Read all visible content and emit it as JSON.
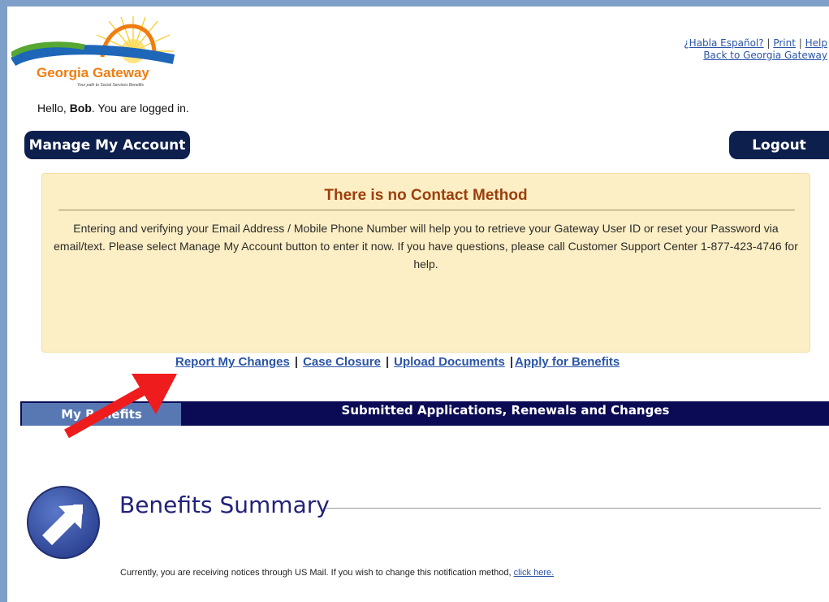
{
  "brand": {
    "name": "Georgia Gateway",
    "tagline": "Your path to Social Services Benefits"
  },
  "top_links": {
    "spanish": "¿Habla Español?",
    "print": "Print",
    "help": "Help",
    "back": "Back to Georgia Gateway",
    "separator": "|"
  },
  "greeting": {
    "prefix": "Hello,",
    "user": "Bob",
    "suffix": ". You are logged in."
  },
  "buttons": {
    "manage_account": "Manage My Account",
    "logout": "Logout"
  },
  "contact_notice": {
    "title": "There is no Contact Method",
    "body": "Entering and verifying your Email Address / Mobile Phone Number will help you to retrieve your Gateway User ID or reset your Password via email/text. Please select Manage My Account button to enter it now. If you have questions, please call Customer Support Center 1-877-423-4746 for help."
  },
  "quick_links": {
    "report_changes": "Report My Changes",
    "case_closure": "Case Closure",
    "upload_documents": "Upload Documents",
    "apply_benefits": "Apply for Benefits",
    "separator": "|"
  },
  "tabs": {
    "my_benefits": "My Benefits",
    "submitted": "Submitted Applications, Renewals and Changes"
  },
  "summary": {
    "title": "Benefits Summary",
    "mail_notice": "Currently, you are receiving notices through US Mail. If you wish to change this notification method,",
    "mail_link": "click here."
  },
  "colors": {
    "navy": "#0d1f4d",
    "tab_active": "#5878b4",
    "notice_bg": "#fdefc5",
    "notice_title": "#9b3f0c",
    "link": "#2b55a6",
    "arrow": "#ee1c1c"
  },
  "icons": {
    "summary_icon": "arrow-up-right-circle-icon",
    "annotation": "red-arrow-icon"
  }
}
